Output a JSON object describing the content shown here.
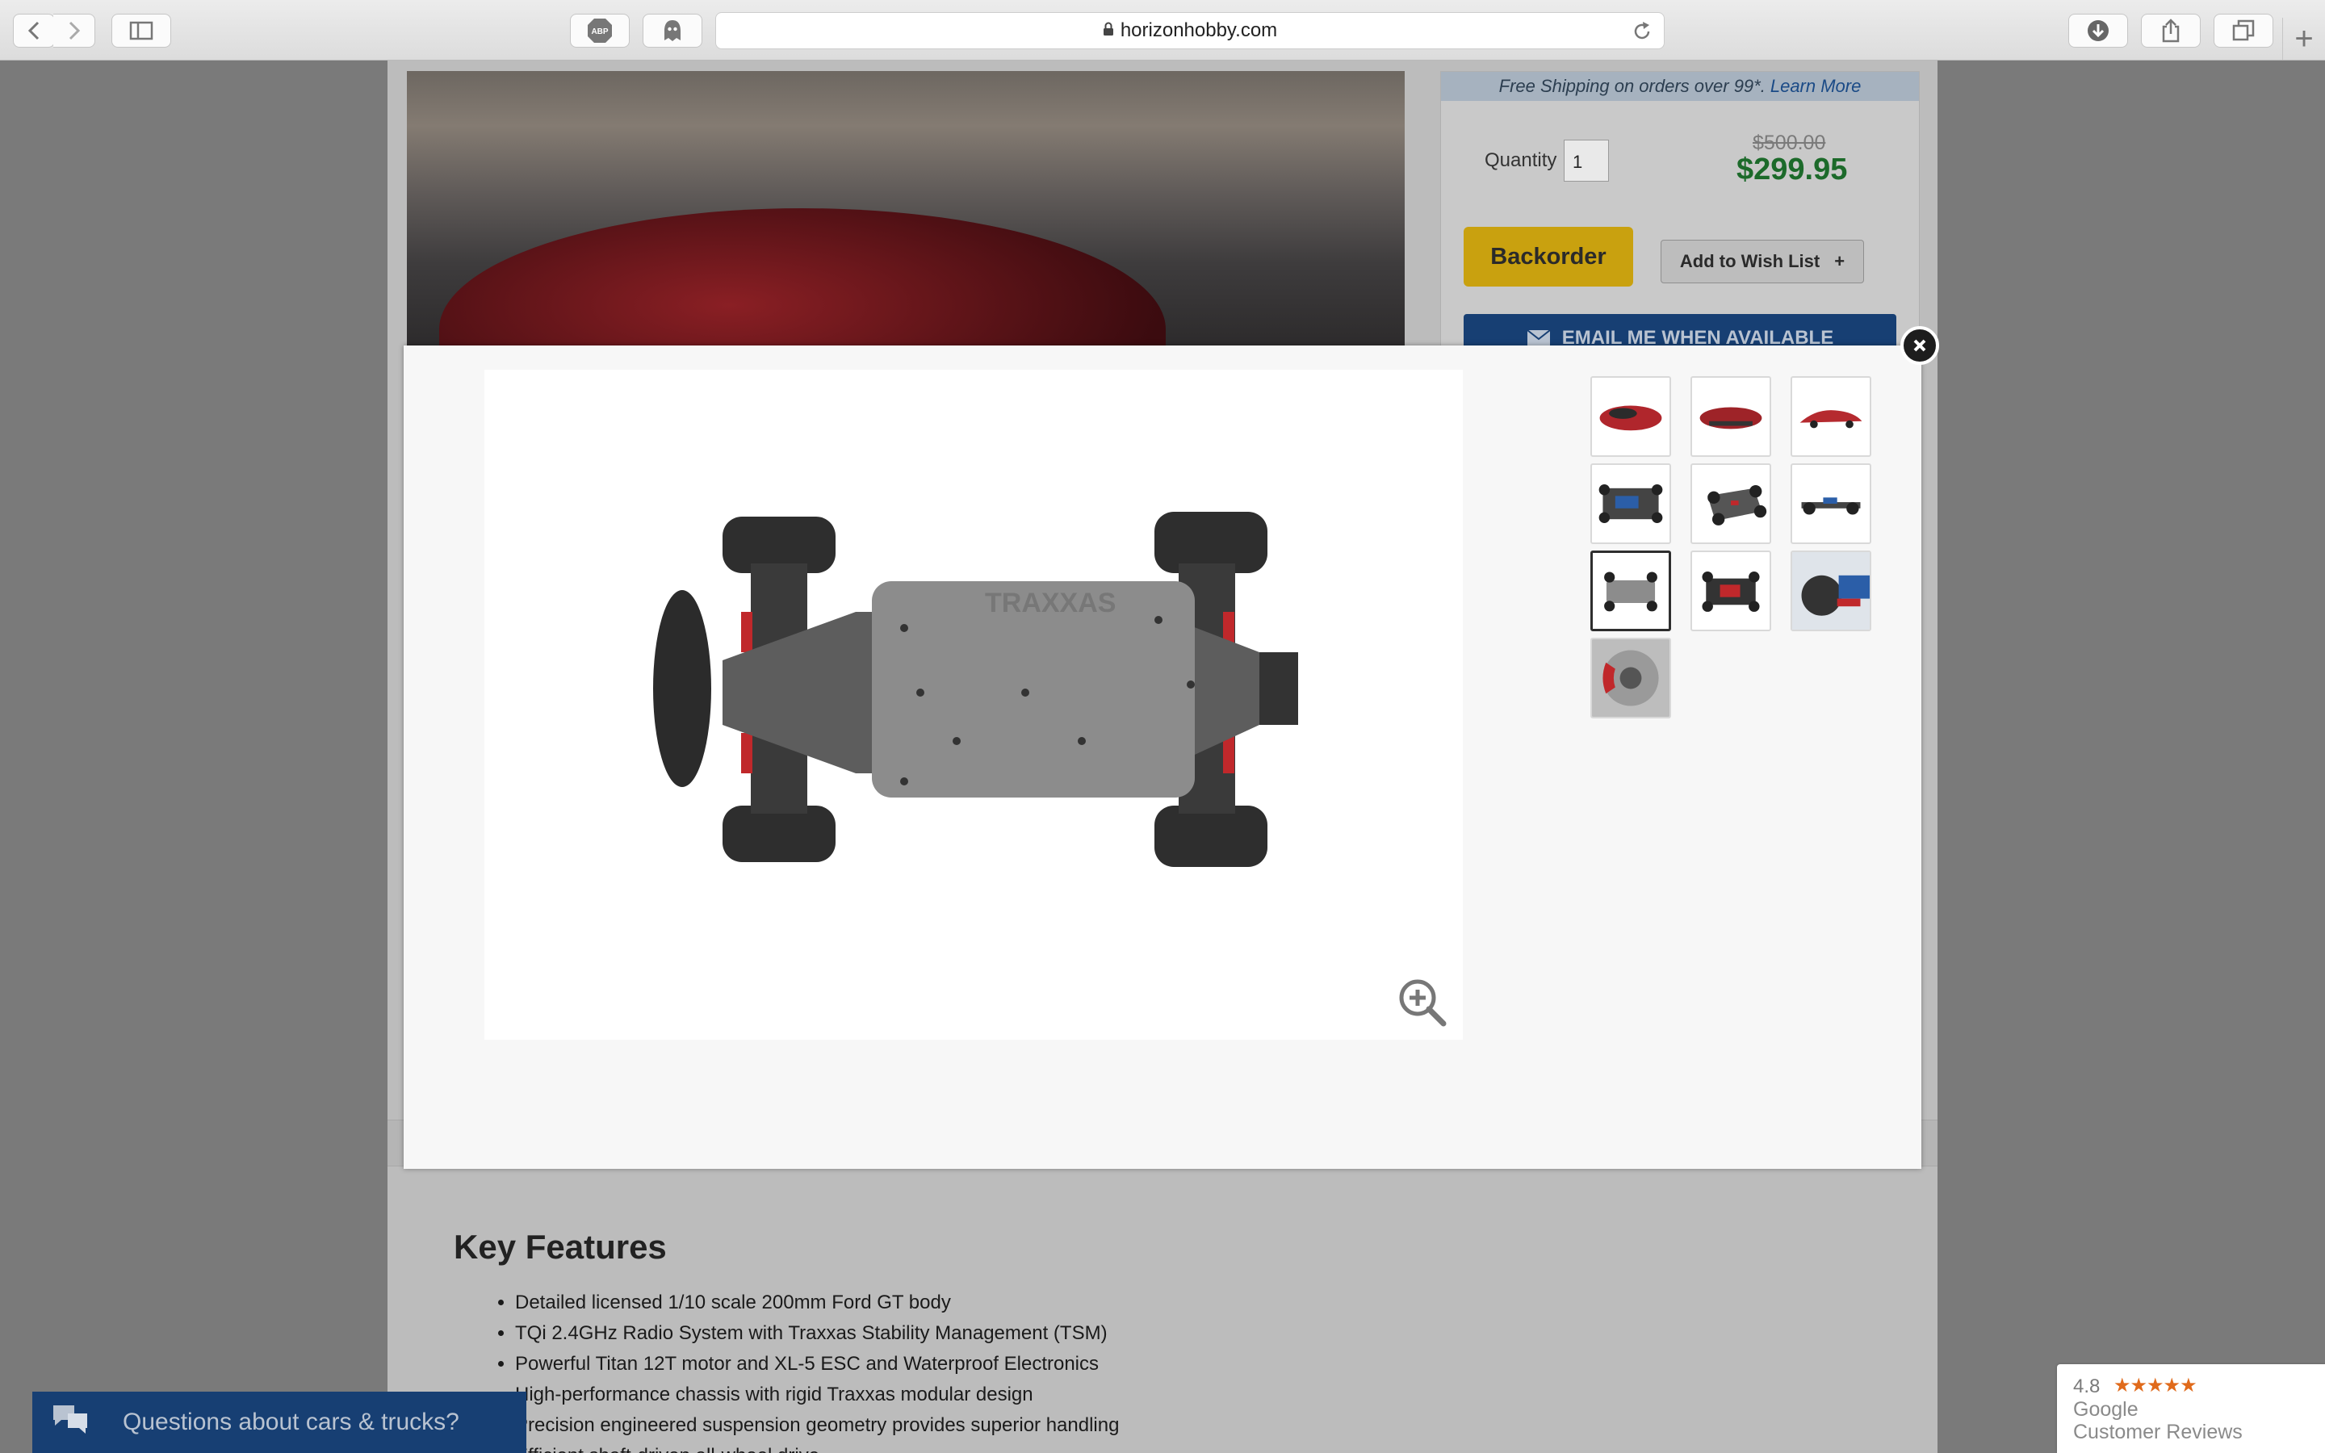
{
  "browser": {
    "url": "horizonhobby.com",
    "buttons": {
      "back": "chevron-left-icon",
      "forward": "chevron-right-icon",
      "sidebar": "sidebar-icon",
      "adblock": "ABP",
      "ghostery": "ghost-icon",
      "reload": "reload-icon",
      "downloads": "download-icon",
      "share": "share-icon",
      "tabs": "tabs-icon",
      "new_tab": "+"
    }
  },
  "product": {
    "shipping_notice": "Free Shipping on orders over 99*.",
    "shipping_link": "Learn More",
    "quantity_label": "Quantity",
    "quantity_value": "1",
    "old_price": "$500.00",
    "price": "$299.95",
    "backorder_label": "Backorder",
    "wishlist_label": "Add to Wish List",
    "wishlist_plus": "+",
    "email_label": "EMAIL ME WHEN AVAILABLE"
  },
  "gallery": {
    "active_index": 6,
    "thumbnails": [
      {
        "name": "body-front-angle"
      },
      {
        "name": "body-rear-angle"
      },
      {
        "name": "body-side"
      },
      {
        "name": "chassis-top-angle"
      },
      {
        "name": "chassis-front-angle"
      },
      {
        "name": "chassis-side"
      },
      {
        "name": "chassis-bottom"
      },
      {
        "name": "chassis-top"
      },
      {
        "name": "suspension-detail"
      },
      {
        "name": "brake-rotor-detail"
      }
    ],
    "zoom_icon": "zoom-in-icon",
    "close_icon": "close-icon"
  },
  "key_features": {
    "title": "Key Features",
    "items": [
      "Detailed licensed 1/10 scale 200mm Ford GT body",
      "TQi 2.4GHz Radio System with Traxxas Stability Management (TSM)",
      "Powerful Titan 12T motor and XL-5 ESC and Waterproof Electronics",
      "High-performance chassis with rigid Traxxas modular design",
      "Precision engineered suspension geometry provides superior handling",
      "Efficient shaft-driven all-wheel drive"
    ]
  },
  "chat": {
    "label": "Questions about cars & trucks?"
  },
  "reviews": {
    "rating": "4.8",
    "stars": "★★★★★",
    "brand": "Google",
    "subtitle": "Customer Reviews"
  },
  "colors": {
    "price_green": "#1c6a2a",
    "backorder_gold": "#c9a10f",
    "brand_blue": "#173f73",
    "star_orange": "#e06a1b"
  }
}
